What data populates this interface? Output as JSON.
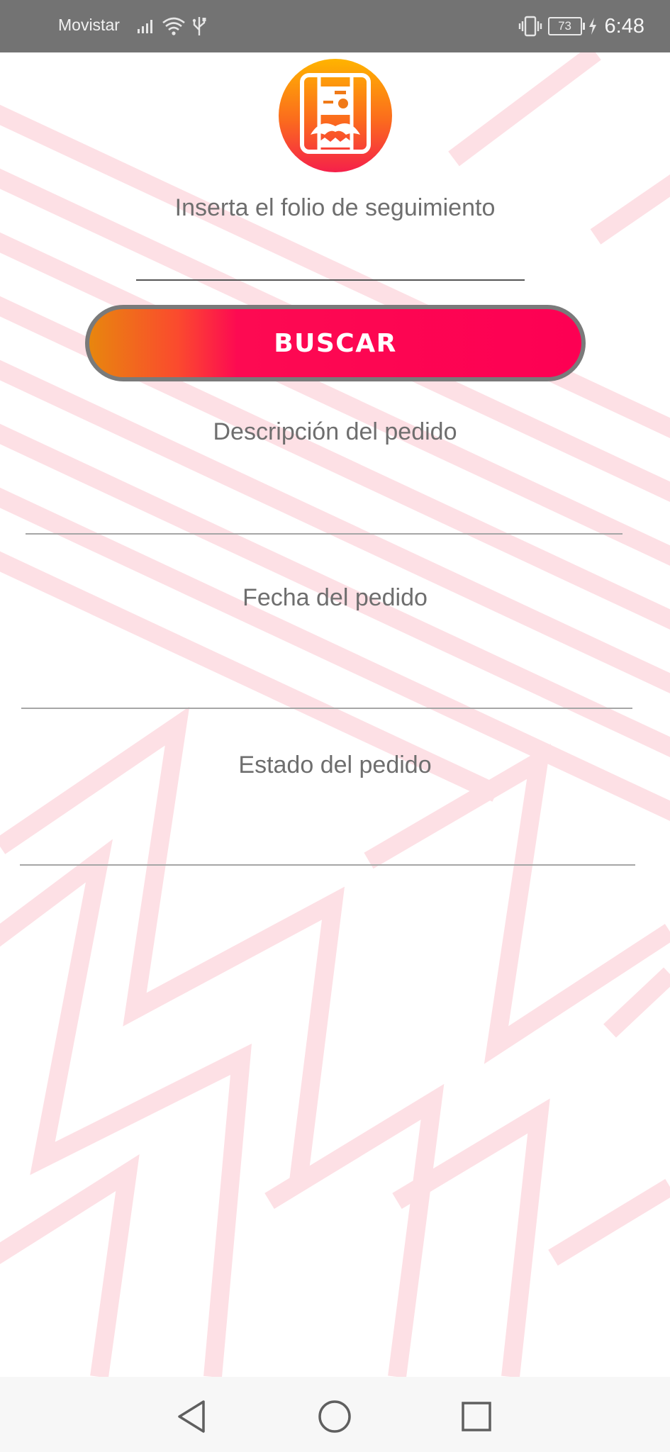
{
  "status_bar": {
    "carrier": "Movistar",
    "battery_level": "73",
    "time": "6:48",
    "icons": [
      "signal-icon",
      "wifi-icon",
      "usb-icon",
      "vibrate-icon",
      "battery-icon",
      "charging-icon"
    ]
  },
  "tracking": {
    "folio_label": "Inserta el folio de seguimiento",
    "folio_value": "",
    "search_label": "BUSCAR",
    "description_label": "Descripción del pedido",
    "description_value": "",
    "date_label": "Fecha del pedido",
    "date_value": "",
    "status_label": "Estado del pedido",
    "status_value": ""
  },
  "nav_bar": {
    "icons": [
      "back-icon",
      "home-icon",
      "recents-icon"
    ]
  },
  "colors": {
    "button_gradient_start": "#e8860e",
    "button_gradient_end": "#fd0053",
    "background_pattern": "#fde0e5",
    "label_text": "#6e6e6e",
    "status_bar_bg": "#737373"
  }
}
